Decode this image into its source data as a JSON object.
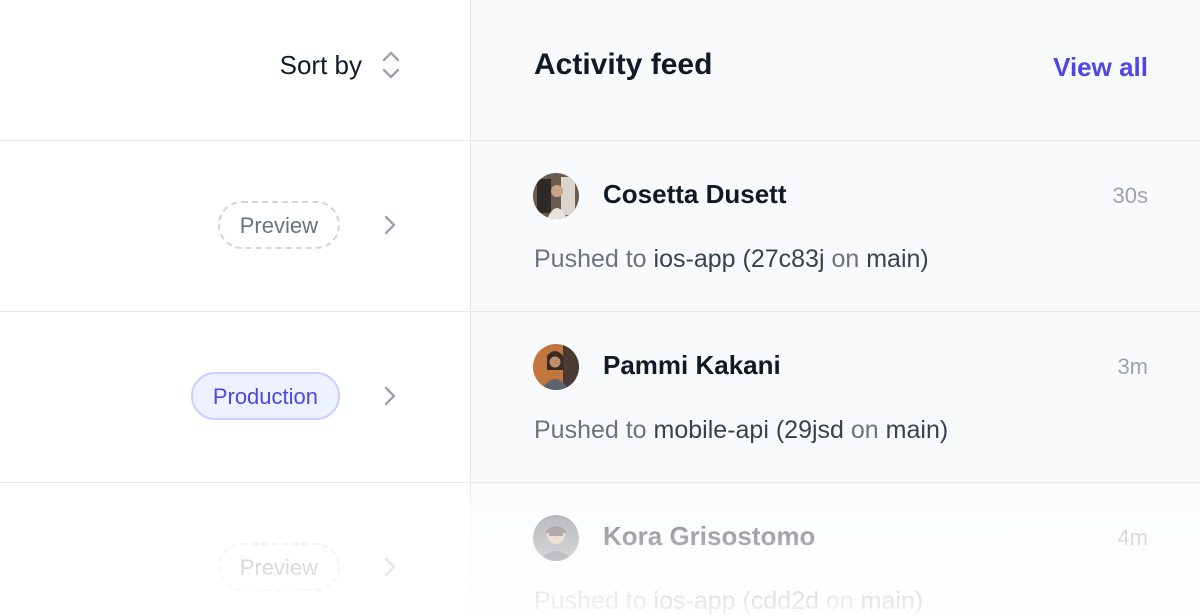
{
  "sort": {
    "label": "Sort by",
    "icon": "sort-updown-icon"
  },
  "feed": {
    "title": "Activity feed",
    "view_all": "View all",
    "accent": "#4f46e5"
  },
  "deployments": [
    {
      "badge": "Preview",
      "type": "preview"
    },
    {
      "badge": "Production",
      "type": "production"
    },
    {
      "badge": "Preview",
      "type": "preview"
    }
  ],
  "activity": [
    {
      "name": "Cosetta Dusett",
      "time": "30s",
      "prefix": "Pushed to",
      "repo": "ios-app",
      "commit": "(27c83j",
      "on": "on",
      "branch": "main)"
    },
    {
      "name": "Pammi Kakani",
      "time": "3m",
      "prefix": "Pushed to",
      "repo": "mobile-api",
      "commit": "(29jsd",
      "on": "on",
      "branch": "main)"
    },
    {
      "name": "Kora Grisostomo",
      "time": "4m",
      "prefix": "Pushed to",
      "repo": "ios-app",
      "commit": "(cdd2d",
      "on": "on",
      "branch": "main)"
    }
  ]
}
